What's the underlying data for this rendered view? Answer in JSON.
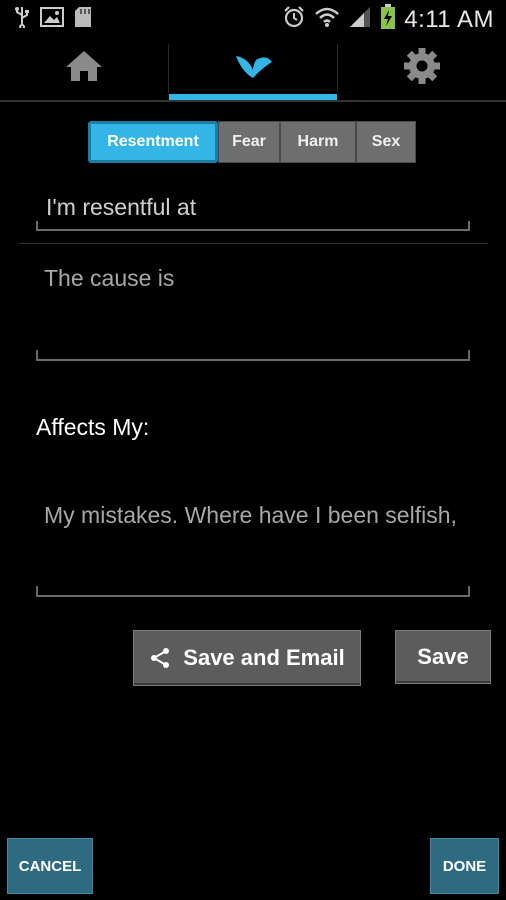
{
  "status_bar": {
    "time": "4:11 AM",
    "icons": [
      "usb-icon",
      "image-icon",
      "sd-card-icon",
      "alarm-icon",
      "wifi-icon",
      "signal-icon",
      "battery-charging-icon"
    ]
  },
  "tabs": [
    {
      "icon": "home-icon"
    },
    {
      "icon": "leaf-icon",
      "selected": true
    },
    {
      "icon": "gear-icon"
    }
  ],
  "segments": [
    "Resentment",
    "Fear",
    "Harm",
    "Sex"
  ],
  "fields": {
    "resentful_at": "I'm resentful at",
    "cause": "The cause is",
    "mistakes": "My mistakes.  Where have I been selfish,"
  },
  "affects_label": "Affects My:",
  "buttons": {
    "save_email": "Save and Email",
    "save": "Save",
    "cancel": "CANCEL",
    "done": "DONE"
  },
  "colors": {
    "accent": "#33b5e5",
    "bottom_button": "#2f6b80"
  }
}
